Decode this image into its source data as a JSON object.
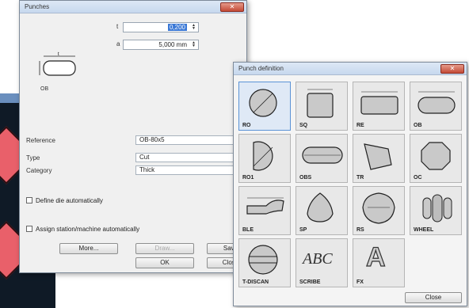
{
  "punches_window": {
    "title": "Punches",
    "t_label": "t",
    "t_value": "0,200",
    "a_label": "a",
    "a_value": "5,000 mm",
    "preview_code": "OB",
    "reference_label": "Reference",
    "reference_value": "OB-80x5",
    "type_label": "Type",
    "type_value": "Cut",
    "category_label": "Category",
    "category_value": "Thick",
    "define_die_label": "Define die automatically",
    "assign_label": "Assign station/machine automatically",
    "more_button": "More...",
    "draw_button": "Draw...",
    "save_button": "Save",
    "ok_button": "OK",
    "close_button": "Close"
  },
  "punch_definition_window": {
    "title": "Punch definition",
    "tiles": [
      {
        "code": "RO",
        "icon": "round-punch-icon"
      },
      {
        "code": "SQ",
        "icon": "square-punch-icon"
      },
      {
        "code": "RE",
        "icon": "rectangle-punch-icon"
      },
      {
        "code": "OB",
        "icon": "obround-punch-icon"
      },
      {
        "code": "RO1",
        "icon": "single-d-punch-icon"
      },
      {
        "code": "OBS",
        "icon": "double-d-punch-icon"
      },
      {
        "code": "TR",
        "icon": "trapezoid-punch-icon"
      },
      {
        "code": "OC",
        "icon": "octagon-punch-icon"
      },
      {
        "code": "BLE",
        "icon": "slot-punch-icon"
      },
      {
        "code": "SP",
        "icon": "special-shape-icon"
      },
      {
        "code": "RS",
        "icon": "round-special-icon"
      },
      {
        "code": "WHEEL",
        "icon": "wheel-tool-icon"
      },
      {
        "code": "T-DISCAN",
        "icon": "disc-cut-icon"
      },
      {
        "code": "SCRIBE",
        "icon": "text-abc-icon",
        "text": "ABC"
      },
      {
        "code": "FX",
        "icon": "letter-a-icon",
        "text": "A"
      }
    ],
    "close_button": "Close"
  },
  "colors": {
    "title_gradient": "#c7d8ee",
    "close_red": "#c44a36",
    "selection_blue": "#3a78d6",
    "background_shape": "#e9606a"
  }
}
